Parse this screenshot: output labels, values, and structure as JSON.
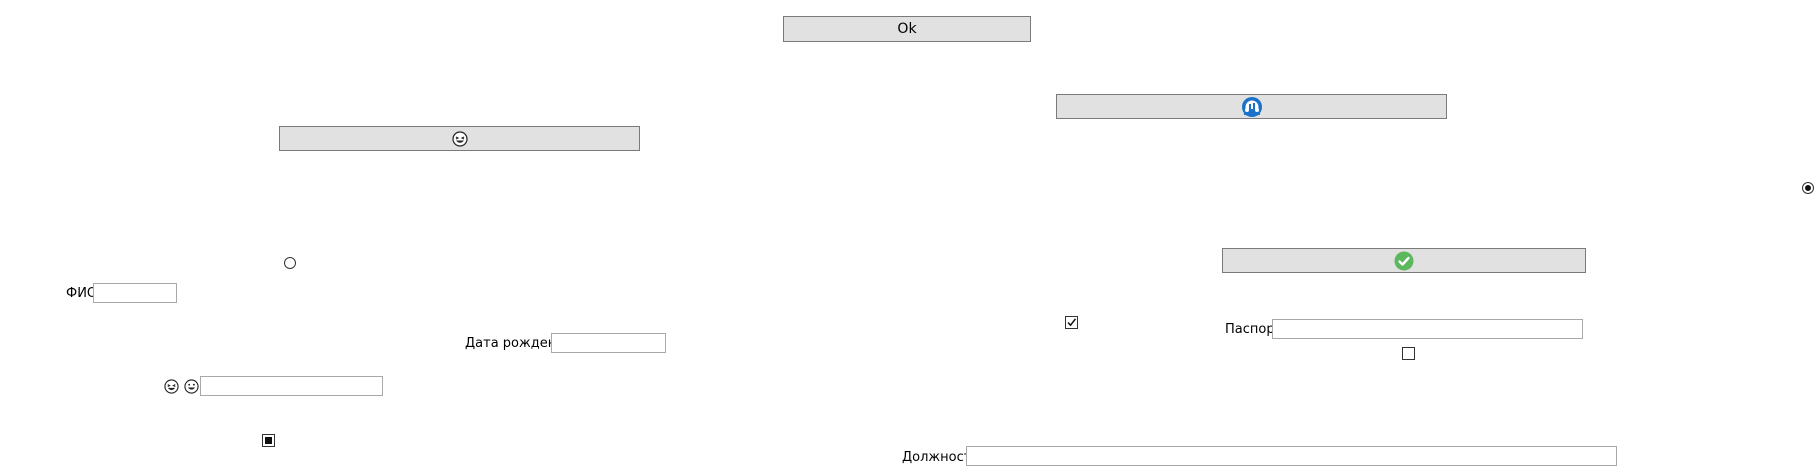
{
  "buttons": {
    "ok_label": "Ok",
    "laugh_button_icon": "grinning-squinting-face-icon",
    "cloud_button_icon": "blue-circle-cloud-icon",
    "check_button_icon": "green-check-circle-icon"
  },
  "form": {
    "fio_label": "ФИО",
    "fio_value": "",
    "birth_label": "Дата рождения",
    "birth_value": "",
    "emoji_field_value": "",
    "passport_label": "Паспорт",
    "passport_value": "",
    "position_label": "Должность",
    "position_value": ""
  },
  "states": {
    "radio_left_selected": false,
    "radio_right_selected": true,
    "checkbox_right_checked": true,
    "checkbox_passport_checked": false,
    "checkbox_bottom_indeterminate": true
  },
  "colors": {
    "button_bg": "#e1e1e1",
    "button_border": "#7a7a7a",
    "cloud_blue": "#1a73c8",
    "check_green": "#5cb85c"
  }
}
